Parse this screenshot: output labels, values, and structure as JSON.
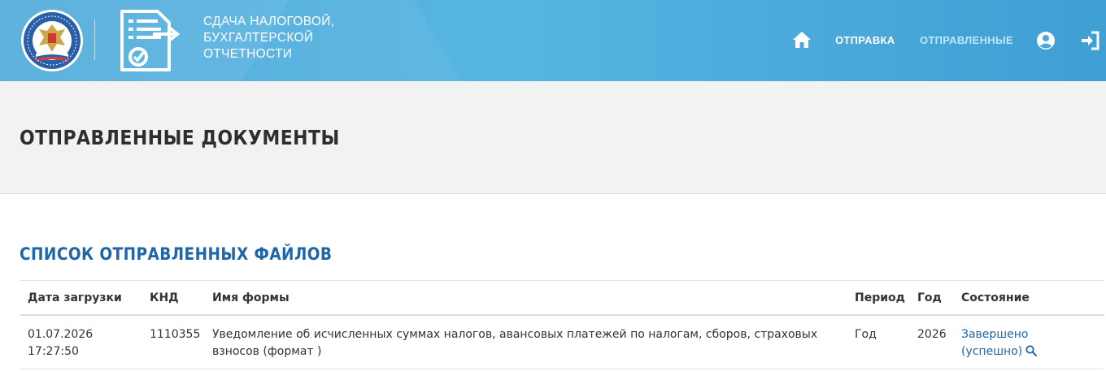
{
  "header": {
    "service_title_lines": [
      "СДАЧА НАЛОГОВОЙ,",
      "БУХГАЛТЕРСКОЙ",
      "ОТЧЕТНОСТИ"
    ],
    "emblem_text": "ФЕДЕРАЛЬНАЯ НАЛОГОВАЯ СЛУЖБА"
  },
  "nav": {
    "home_icon": "home-icon",
    "send_label": "ОТПРАВКА",
    "sent_label": "ОТПРАВЛЕННЫЕ",
    "user_icon": "user-icon",
    "exit_icon": "logout-icon"
  },
  "page": {
    "title": "ОТПРАВЛЕННЫЕ ДОКУМЕНТЫ",
    "section_title": "СПИСОК ОТПРАВЛЕННЫХ ФАЙЛОВ"
  },
  "table": {
    "headers": {
      "date": "Дата загрузки",
      "knd": "КНД",
      "form": "Имя формы",
      "period": "Период",
      "year": "Год",
      "status": "Состояние"
    },
    "rows": [
      {
        "date": "01.07.2026",
        "time": "17:27:50",
        "knd": "1110355",
        "form": "Уведомление об исчисленных суммах налогов, авансовых платежей по налогам, сборов, страховых взносов (формат )",
        "period": "Год",
        "year": "2026",
        "status_line1": "Завершено",
        "status_line2": "(успешно)"
      }
    ]
  },
  "colors": {
    "header_blue": "#4aa9d9",
    "link_blue": "#1f66a8",
    "nav_active": "#bfe6fb"
  }
}
